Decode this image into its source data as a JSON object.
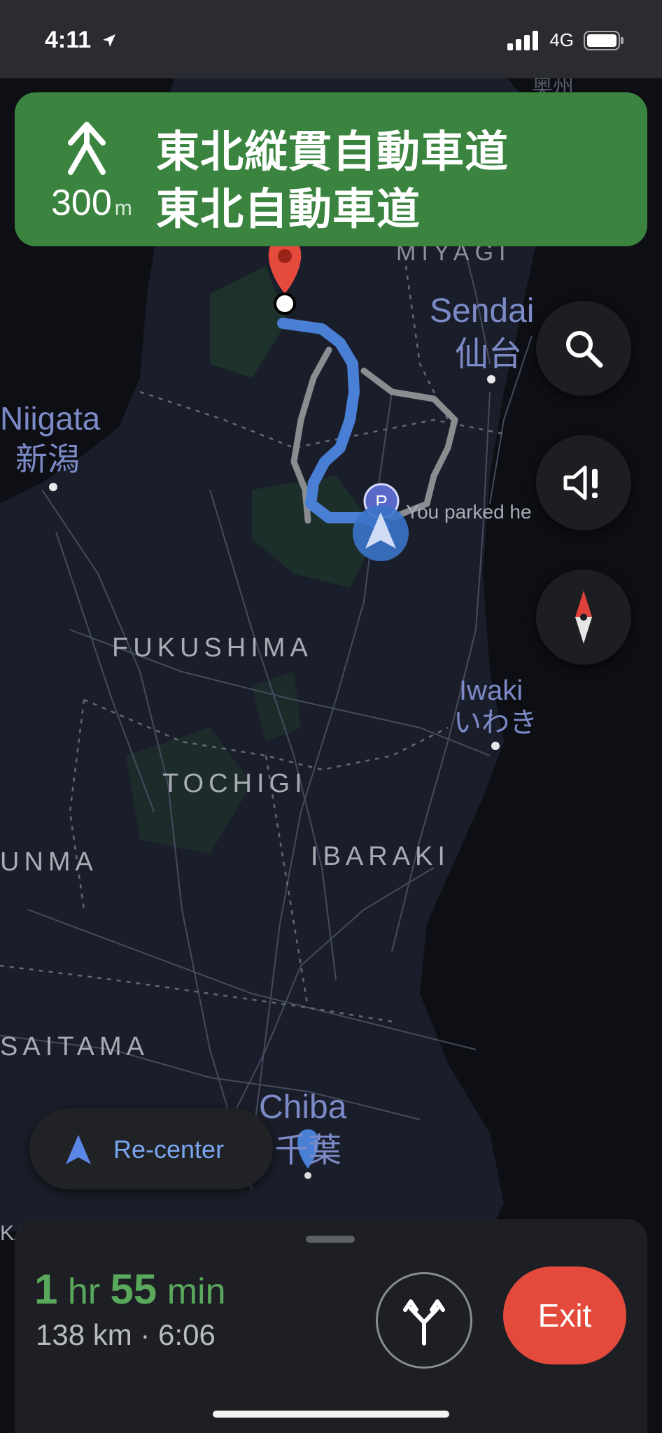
{
  "status_bar": {
    "time": "4:11",
    "network": "4G"
  },
  "banner": {
    "distance": "300",
    "distance_unit": "m",
    "road_primary": "東北縦貫自動車道",
    "road_secondary": "東北自動車道",
    "color": "#3a8440"
  },
  "map": {
    "labels": {
      "miyagi": "MIYAGI",
      "oshu": "奥州",
      "sendai_en": "Sendai",
      "sendai_jp": "仙台",
      "niigata_en": "Niigata",
      "niigata_jp": "新潟",
      "fukushima": "FUKUSHIMA",
      "iwaki_en": "Iwaki",
      "iwaki_jp": "いわき",
      "tochigi": "TOCHIGI",
      "gunma": "UNMA",
      "ibaraki": "IBARAKI",
      "saitama": "SAITAMA",
      "chiba_en": "Chiba",
      "chiba_jp": "千葉",
      "ka": "KA",
      "parked": "You parked he"
    },
    "parking_badge": "P",
    "route_color": "#4a7fd6",
    "alt_route_color": "#8a8c90"
  },
  "controls": {
    "search_icon": "search-icon",
    "sound_icon": "sound-alert-icon",
    "compass_icon": "compass-icon",
    "recenter_label": "Re-center"
  },
  "trip": {
    "eta_hr_num": "1",
    "eta_hr_unit": "hr",
    "eta_min_num": "55",
    "eta_min_unit": "min",
    "details": "138 km · 6:06",
    "exit_label": "Exit",
    "eta_color": "#5aa85c",
    "exit_color": "#e34a3c"
  }
}
